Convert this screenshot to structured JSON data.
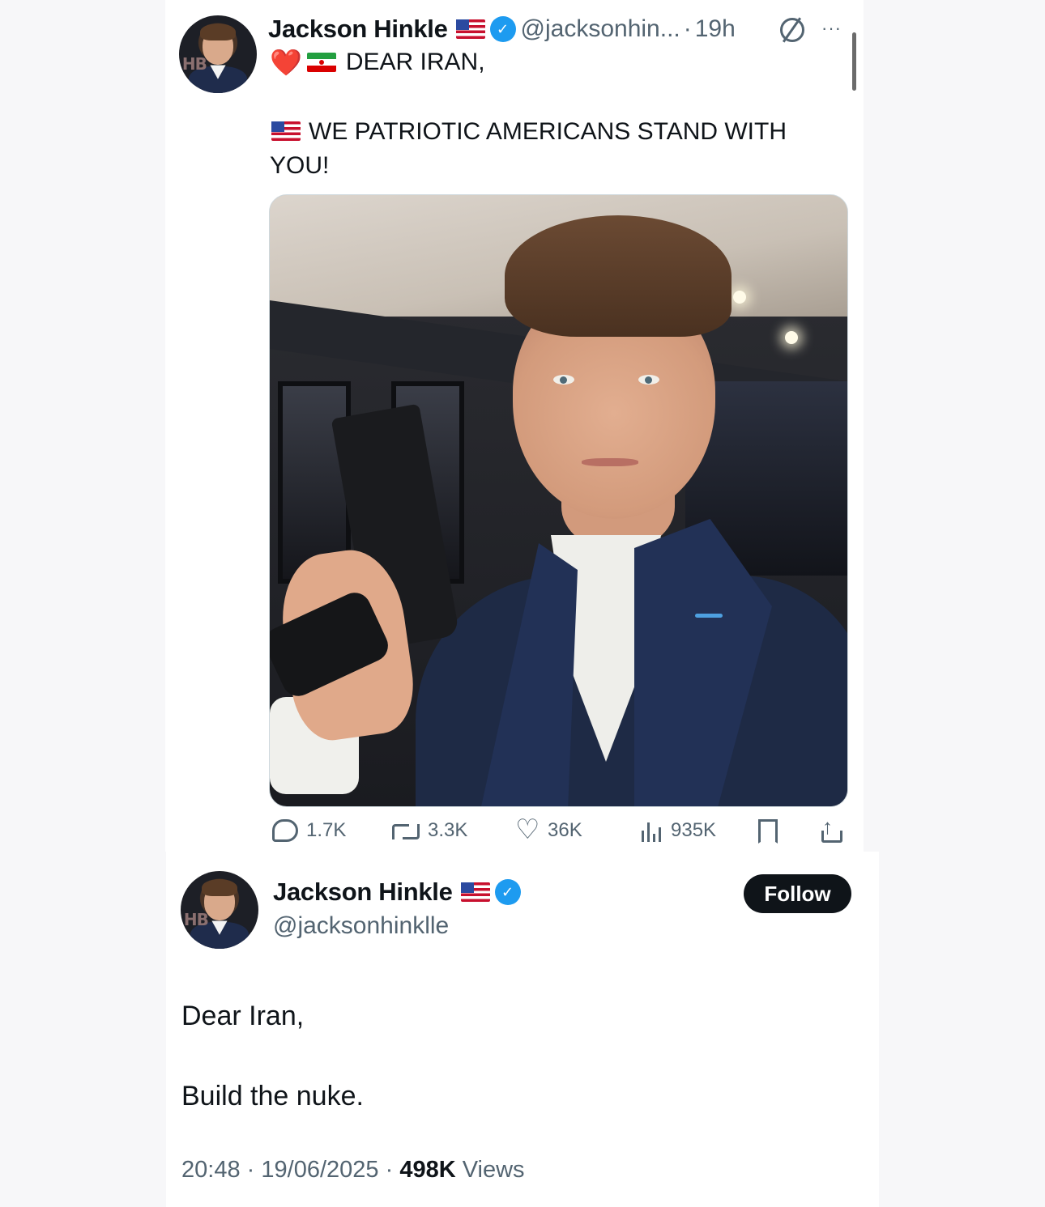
{
  "tweet1": {
    "author_name": "Jackson Hinkle",
    "handle": "@jacksonhin...",
    "separator": "·",
    "time": "19h",
    "more_label": "···",
    "line1_text": "DEAR IRAN,",
    "line2_text": "WE PATRIOTIC AMERICANS STAND WITH YOU!",
    "heart_emoji": "❤️",
    "stats": {
      "replies": "1.7K",
      "reposts": "3.3K",
      "likes": "36K",
      "views": "935K"
    }
  },
  "tweet2": {
    "author_name": "Jackson Hinkle",
    "handle": "@jacksonhinklle",
    "follow_label": "Follow",
    "verified_mark": "✓",
    "body_line1": "Dear Iran,",
    "body_line2": "Build the nuke.",
    "time": "20:48",
    "date": "19/06/2025",
    "views_count": "498K",
    "views_label": "Views",
    "sep": "·"
  },
  "colors": {
    "accent_blue": "#1d9bf0",
    "text_primary": "#0f1419",
    "text_secondary": "#536471",
    "follow_bg": "#0f1419"
  },
  "icons": [
    "verified-icon",
    "us-flag-icon",
    "iran-flag-icon",
    "heart-emoji-icon",
    "grok-icon",
    "more-icon",
    "reply-icon",
    "repost-icon",
    "like-icon",
    "views-icon",
    "bookmark-icon",
    "share-icon"
  ]
}
